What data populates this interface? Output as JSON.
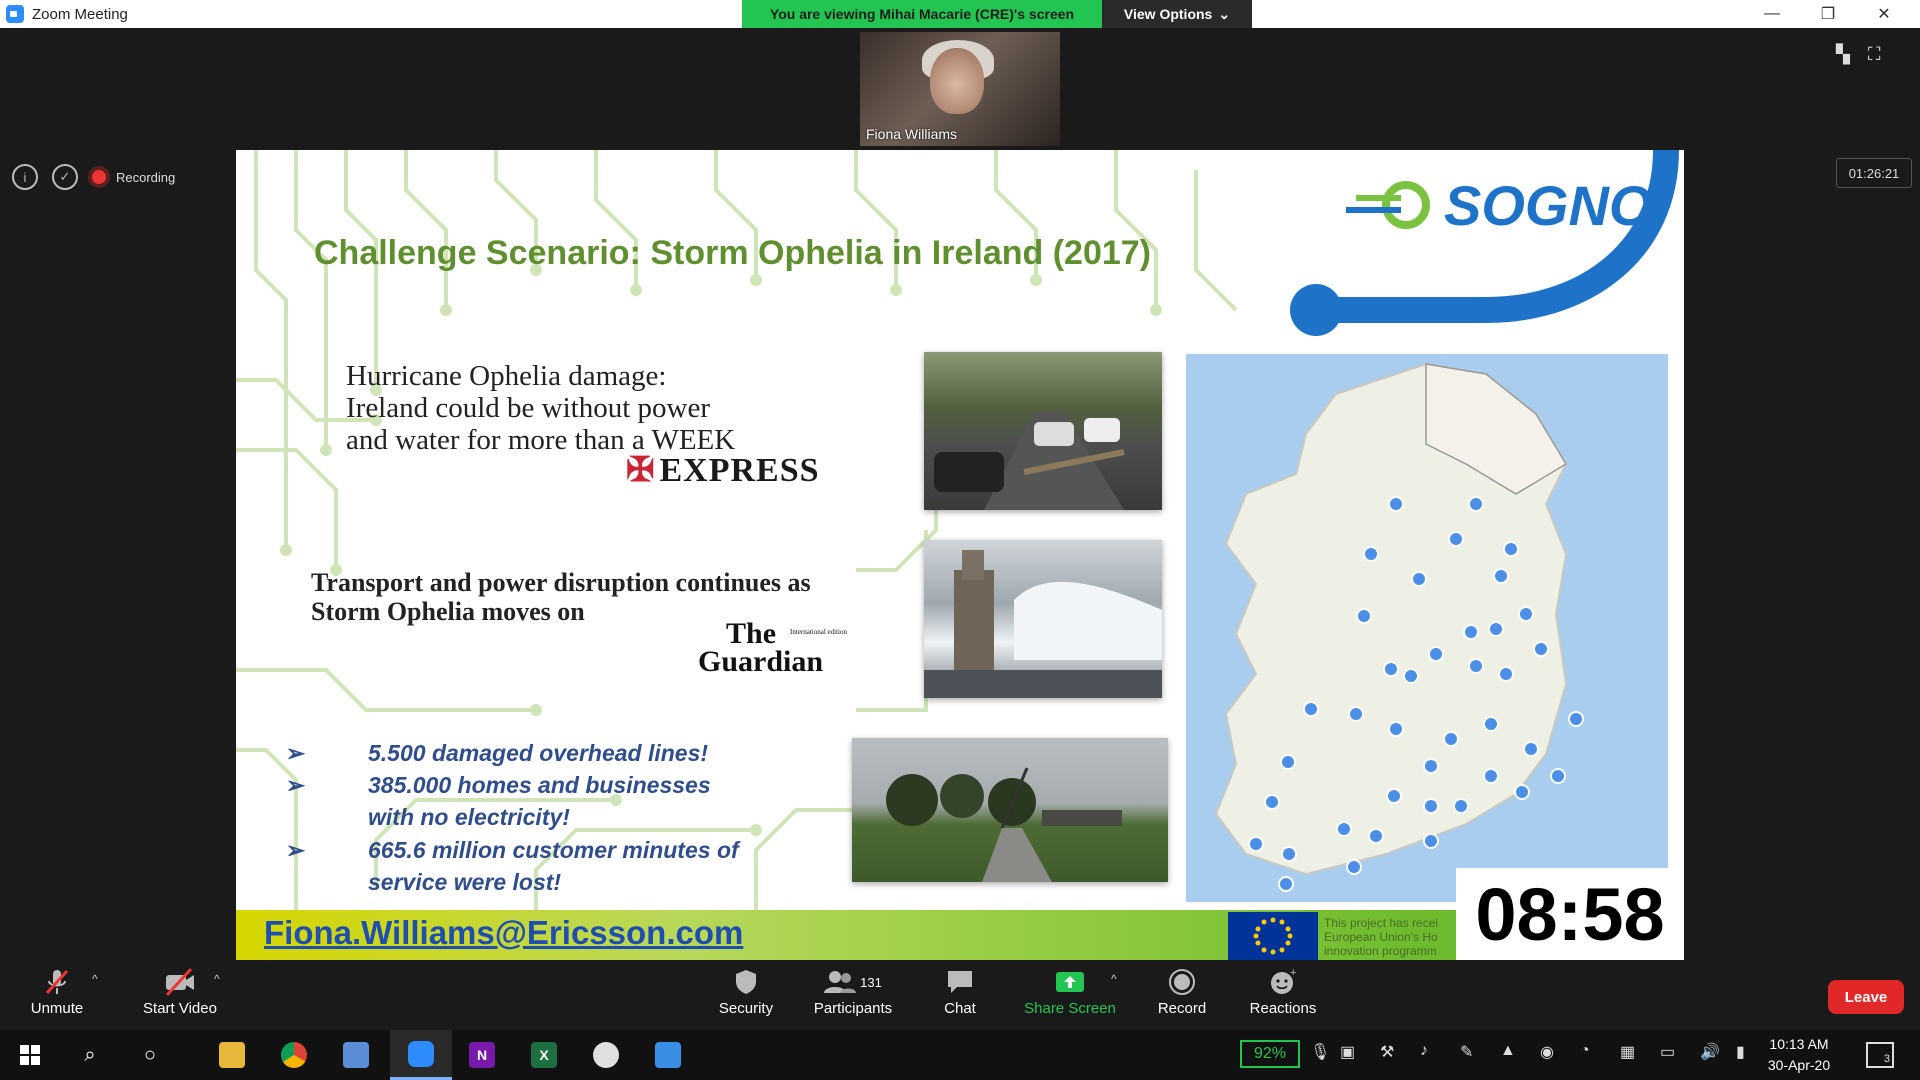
{
  "window": {
    "title": "Zoom Meeting",
    "viewing_banner": "You are viewing Mihai Macarie (CRE)'s screen",
    "view_options": "View Options"
  },
  "meeting": {
    "participant_name": "Fiona Williams",
    "recording_label": "Recording",
    "elapsed_time": "01:26:21"
  },
  "slide": {
    "title": "Challenge Scenario: Storm Ophelia in Ireland (2017)",
    "logo_text": "SOGNO",
    "headline1": [
      "Hurricane Ophelia damage:",
      "Ireland could be without power",
      "and water for more than a WEEK"
    ],
    "source1": "EXPRESS",
    "headline2": [
      "Transport and power disruption continues as",
      "Storm Ophelia moves on"
    ],
    "source2_line1": "The",
    "source2_line2": "Guardian",
    "source2_tag": "International edition",
    "bullets": [
      [
        "5.500 damaged overhead lines!"
      ],
      [
        "385.000 homes and businesses",
        "with no electricity!"
      ],
      [
        "665.6 million customer minutes of",
        "service were lost!"
      ]
    ],
    "email": "Fiona.Williams@Ericsson.com",
    "eu_text": [
      "This project has recei",
      "European Union's Ho",
      "innovation programm"
    ],
    "countdown": "08:58"
  },
  "toolbar": {
    "unmute": "Unmute",
    "start_video": "Start Video",
    "security": "Security",
    "participants": "Participants",
    "participant_count": "131",
    "chat": "Chat",
    "share_screen": "Share Screen",
    "record": "Record",
    "reactions": "Reactions",
    "leave": "Leave"
  },
  "taskbar": {
    "battery": "92%",
    "time": "10:13 AM",
    "date": "30-Apr-20",
    "notifications": "3"
  },
  "colors": {
    "zoom_green": "#23c552",
    "title_green": "#5f8f2e",
    "bullet_blue": "#2f4d8c",
    "email_blue": "#1f4fae",
    "leave_red": "#e02828"
  }
}
